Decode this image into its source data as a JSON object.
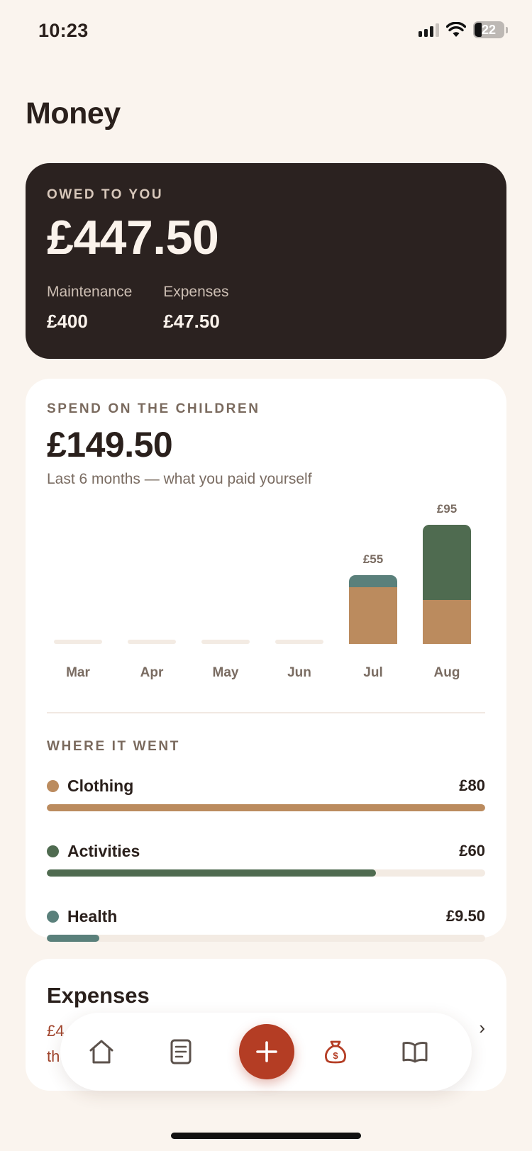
{
  "status_bar": {
    "time": "10:23",
    "battery": "22"
  },
  "page": {
    "title": "Money"
  },
  "owed_card": {
    "label": "OWED TO YOU",
    "amount": "£447.50",
    "items": [
      {
        "label": "Maintenance",
        "value": "£400"
      },
      {
        "label": "Expenses",
        "value": "£47.50"
      }
    ]
  },
  "spend_card": {
    "label": "SPEND ON THE CHILDREN",
    "amount": "£149.50",
    "subtitle": "Last 6 months — what you paid yourself",
    "where_label": "WHERE IT WENT",
    "categories": [
      {
        "name": "Clothing",
        "value": "£80",
        "amount": 80,
        "fraction": 1.0,
        "color": "#bb8b5e"
      },
      {
        "name": "Activities",
        "value": "£60",
        "amount": 60,
        "fraction": 0.75,
        "color": "#4f6b50"
      },
      {
        "name": "Health",
        "value": "£9.50",
        "amount": 9.5,
        "fraction": 0.119,
        "color": "#5a807b"
      }
    ]
  },
  "chart_data": {
    "type": "bar",
    "stacked": true,
    "categories": [
      "Mar",
      "Apr",
      "May",
      "Jun",
      "Jul",
      "Aug"
    ],
    "totals_labels": [
      "",
      "",
      "",
      "",
      "£55",
      "£95"
    ],
    "series": [
      {
        "name": "Clothing",
        "color": "#bb8b5e",
        "values": [
          0,
          0,
          0,
          0,
          45,
          35
        ]
      },
      {
        "name": "Activities",
        "color": "#4f6b50",
        "values": [
          0,
          0,
          0,
          0,
          0,
          60
        ]
      },
      {
        "name": "Health",
        "color": "#5a807b",
        "values": [
          0,
          0,
          0,
          0,
          10,
          0
        ]
      }
    ],
    "ylim": [
      0,
      95
    ]
  },
  "expenses_card": {
    "title": "Expenses",
    "subtitle_start": "£4",
    "subtitle_line2": "th"
  },
  "tab_bar": {
    "tabs": [
      "home-icon",
      "document-icon",
      "add-icon",
      "money-bag-icon",
      "book-icon"
    ],
    "active": "money-bag-icon",
    "accent": "#b43d24"
  }
}
